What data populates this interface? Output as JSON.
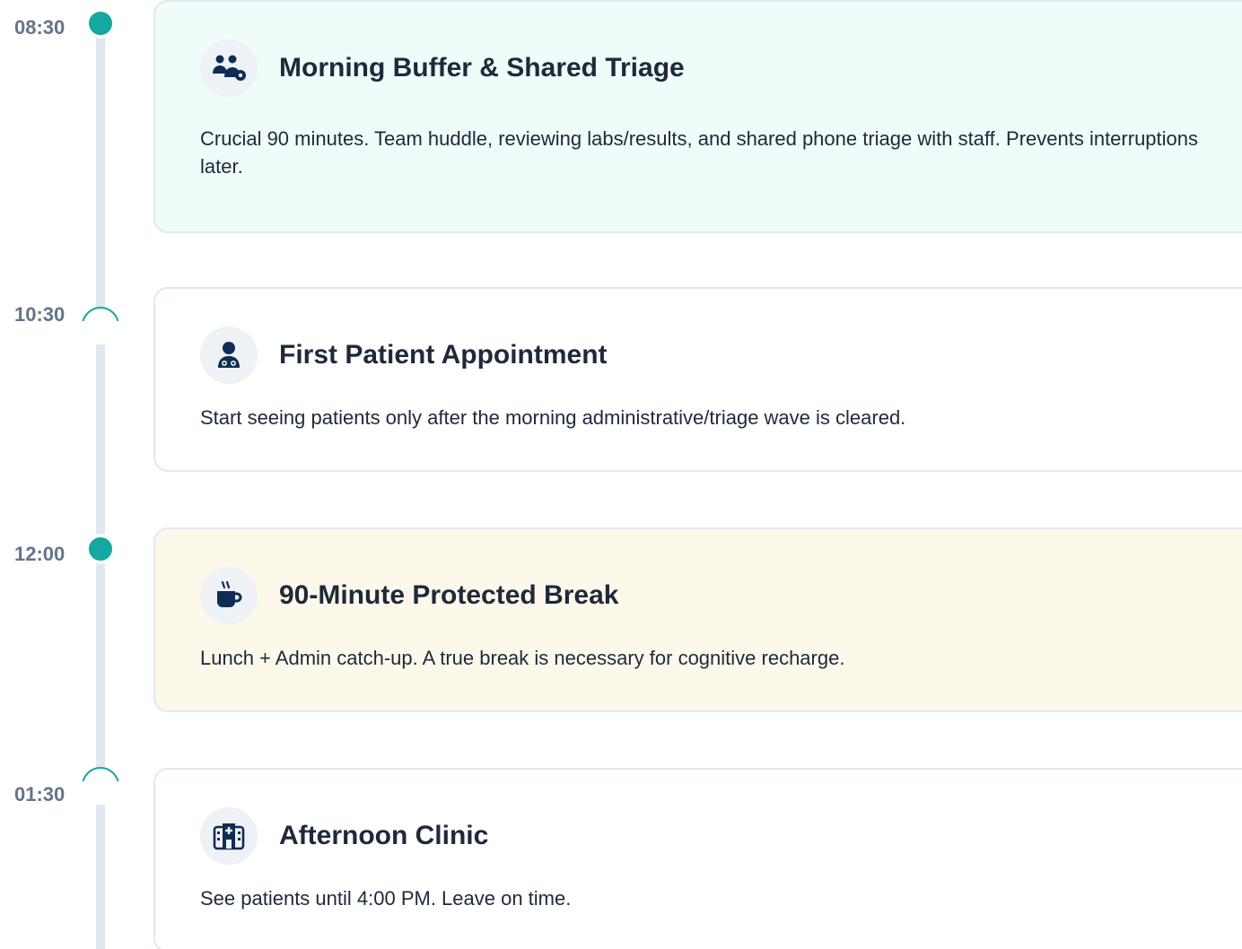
{
  "colors": {
    "accent": "#14a8a0",
    "spine": "#e2e8f0",
    "time_text": "#64748b",
    "title_text": "#1e293b",
    "teal_card": "#effcfa",
    "cream_card": "#fdf9ea",
    "icon_fill": "#0f2d52"
  },
  "events": [
    {
      "time": "08:30",
      "node": "filled",
      "icon": "team-triage-icon",
      "title": "Morning Buffer & Shared Triage",
      "description": "Crucial 90 minutes. Team huddle, reviewing labs/results, and shared phone triage with staff. Prevents interruptions later."
    },
    {
      "time": "10:30",
      "node": "hollow",
      "icon": "doctor-icon",
      "title": "First Patient Appointment",
      "description": "Start seeing patients only after the morning administrative/triage wave is cleared."
    },
    {
      "time": "12:00",
      "node": "filled",
      "icon": "coffee-mug-icon",
      "title": "90-Minute Protected Break",
      "description": "Lunch + Admin catch-up. A true break is necessary for cognitive recharge."
    },
    {
      "time": "01:30",
      "node": "hollow",
      "icon": "hospital-icon",
      "title": "Afternoon Clinic",
      "description": "See patients until 4:00 PM. Leave on time."
    }
  ]
}
